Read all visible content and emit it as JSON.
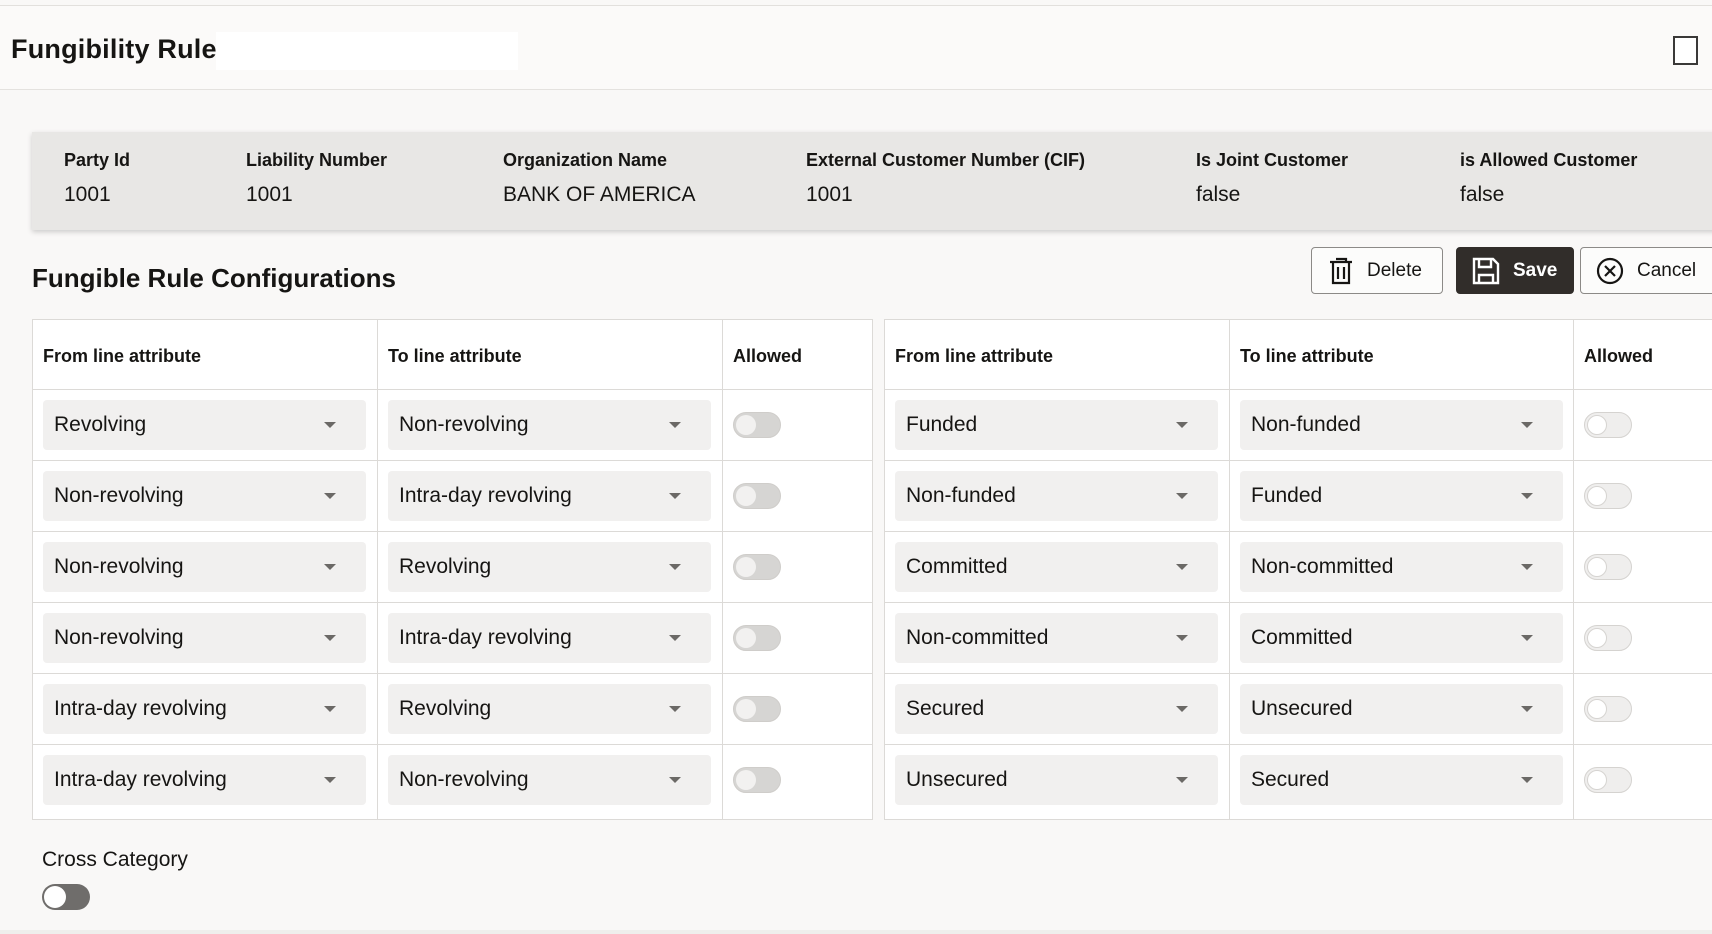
{
  "header": {
    "title": "Fungibility Rule"
  },
  "info": [
    {
      "label": "Party Id",
      "value": "1001"
    },
    {
      "label": "Liability Number",
      "value": "1001"
    },
    {
      "label": "Organization Name",
      "value": "BANK OF AMERICA"
    },
    {
      "label": "External Customer Number (CIF)",
      "value": "1001"
    },
    {
      "label": "Is Joint Customer",
      "value": "false"
    },
    {
      "label": "is Allowed Customer",
      "value": "false"
    }
  ],
  "section": {
    "title": "Fungible Rule Configurations"
  },
  "toolbar": {
    "delete_label": "Delete",
    "save_label": "Save",
    "cancel_label": "Cancel",
    "delete_icon": "trash-icon",
    "save_icon": "floppy-disk-icon",
    "cancel_icon": "circle-x-icon"
  },
  "columns": {
    "from": "From line attribute",
    "to": "To line attribute",
    "allowed": "Allowed"
  },
  "left_rows": [
    {
      "from": "Revolving",
      "to": "Non-revolving",
      "allowed": false
    },
    {
      "from": "Non-revolving",
      "to": "Intra-day revolving",
      "allowed": false
    },
    {
      "from": "Non-revolving",
      "to": "Revolving",
      "allowed": false
    },
    {
      "from": "Non-revolving",
      "to": "Intra-day revolving",
      "allowed": false
    },
    {
      "from": "Intra-day revolving",
      "to": "Revolving",
      "allowed": false
    },
    {
      "from": "Intra-day revolving",
      "to": "Non-revolving",
      "allowed": false
    }
  ],
  "right_rows": [
    {
      "from": "Funded",
      "to": "Non-funded",
      "allowed": false
    },
    {
      "from": "Non-funded",
      "to": "Funded",
      "allowed": false
    },
    {
      "from": "Committed",
      "to": "Non-committed",
      "allowed": false
    },
    {
      "from": "Non-committed",
      "to": "Committed",
      "allowed": false
    },
    {
      "from": "Secured",
      "to": "Unsecured",
      "allowed": false
    },
    {
      "from": "Unsecured",
      "to": "Secured",
      "allowed": false
    }
  ],
  "cross_category": {
    "label": "Cross Category",
    "enabled": false
  }
}
